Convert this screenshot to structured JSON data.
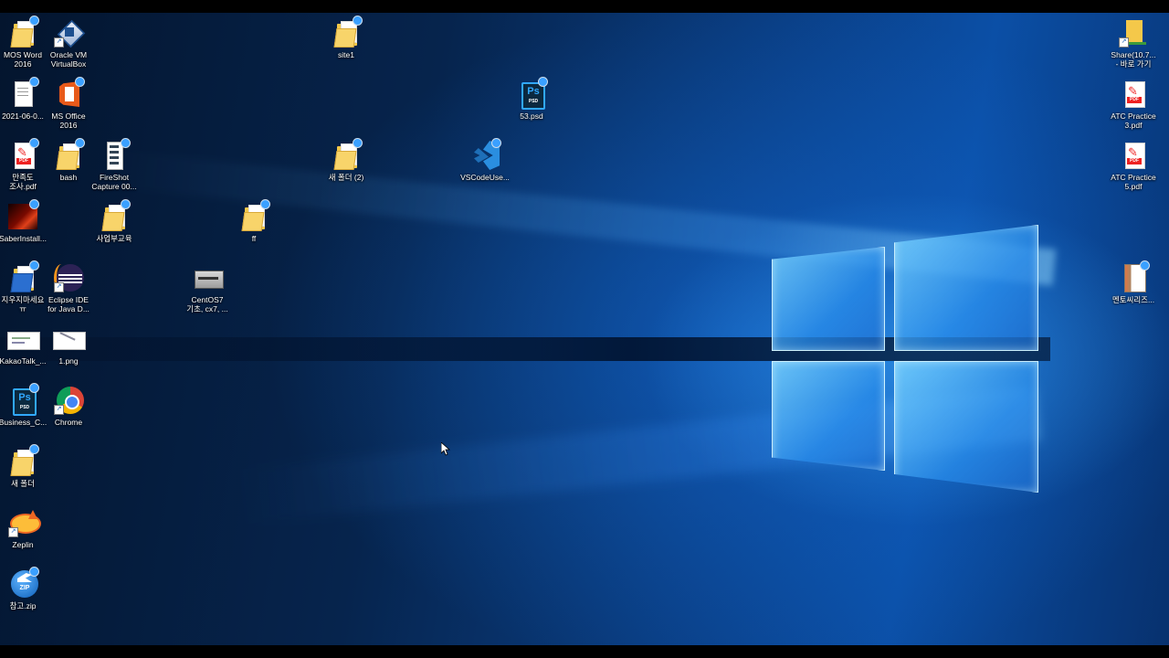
{
  "icons": [
    {
      "id": "mos-word",
      "label": "MOS Word\n2016",
      "type": "folder"
    },
    {
      "id": "oracle-vm",
      "label": "Oracle VM\nVirtualBox",
      "type": "vbox"
    },
    {
      "id": "doc-2021",
      "label": "2021-06-0...",
      "type": "doc"
    },
    {
      "id": "ms-office",
      "label": "MS Office\n2016",
      "type": "office"
    },
    {
      "id": "survey-pdf",
      "label": "만족도\n조사.pdf",
      "type": "pdf"
    },
    {
      "id": "bash",
      "label": "bash",
      "type": "folder"
    },
    {
      "id": "fireshot",
      "label": "FireShot\nCapture 00...",
      "type": "fireshot"
    },
    {
      "id": "saber",
      "label": "SaberInstall...",
      "type": "saber"
    },
    {
      "id": "business-edu",
      "label": "사업부교육",
      "type": "folder"
    },
    {
      "id": "ff",
      "label": "ff",
      "type": "folder"
    },
    {
      "id": "jiujima",
      "label": "지우지마세요\nㅠ",
      "type": "folder"
    },
    {
      "id": "eclipse",
      "label": "Eclipse IDE\nfor Java D...",
      "type": "eclipse"
    },
    {
      "id": "centos",
      "label": "CentOS7\n기초, cx7, ...",
      "type": "disk"
    },
    {
      "id": "kakaotalk",
      "label": "KakaoTalk_...",
      "type": "thumb"
    },
    {
      "id": "png1",
      "label": "1.png",
      "type": "thumb"
    },
    {
      "id": "business-c",
      "label": "Business_C...",
      "type": "psd"
    },
    {
      "id": "chrome",
      "label": "Chrome",
      "type": "chrome"
    },
    {
      "id": "new-folder",
      "label": "새 폴더",
      "type": "folder"
    },
    {
      "id": "zeplin",
      "label": "Zeplin",
      "type": "zeplin"
    },
    {
      "id": "ref-zip",
      "label": "참고.zip",
      "type": "zip"
    },
    {
      "id": "site1",
      "label": "site1",
      "type": "folder"
    },
    {
      "id": "new-folder-2",
      "label": "새 폴더 (2)",
      "type": "folder"
    },
    {
      "id": "psd-53",
      "label": "53.psd",
      "type": "psd"
    },
    {
      "id": "vscode",
      "label": "VSCodeUse...",
      "type": "vscode"
    },
    {
      "id": "share",
      "label": "Share(10.7...\n- 바로 가기",
      "type": "netfolder"
    },
    {
      "id": "atc3",
      "label": "ATC Practice\n3.pdf",
      "type": "pdf"
    },
    {
      "id": "atc5",
      "label": "ATC Practice\n5.pdf",
      "type": "pdf"
    },
    {
      "id": "mentor",
      "label": "멘토씨리즈...",
      "type": "archive"
    }
  ]
}
